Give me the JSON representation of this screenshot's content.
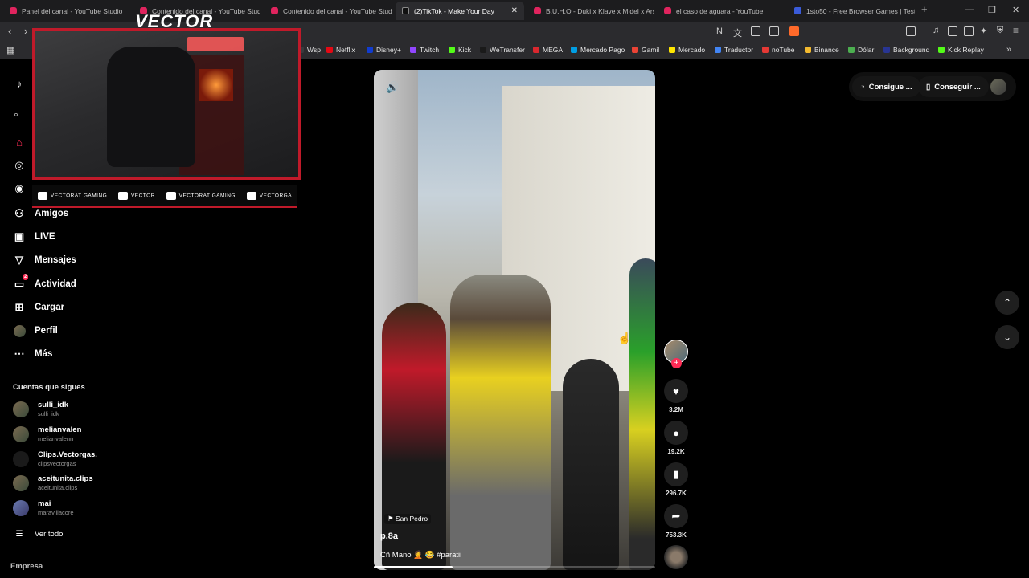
{
  "browser": {
    "tabs": [
      {
        "title": "Panel del canal - YouTube Studio",
        "icon": "youtube-studio-icon",
        "active": false
      },
      {
        "title": "Contenido del canal - YouTube Studio",
        "icon": "youtube-studio-icon",
        "active": false
      },
      {
        "title": "Contenido del canal - YouTube Studio",
        "icon": "youtube-studio-icon",
        "active": false
      },
      {
        "title": "(2)TikTok - Make Your Day",
        "icon": "tiktok-icon",
        "active": true
      },
      {
        "title": "B.U.H.O - Duki x Klave x Midel x Arse",
        "icon": "youtube-icon",
        "active": false
      },
      {
        "title": "el caso de aguara - YouTube",
        "icon": "youtube-icon",
        "active": false
      },
      {
        "title": "1sto50 - Free Browser Games | Test Y",
        "icon": "games-icon",
        "active": false
      }
    ],
    "new_tab": "+",
    "bookmarks": [
      {
        "label": "Wsp",
        "color": "#3a3a3d"
      },
      {
        "label": "Netflix",
        "color": "#e50914"
      },
      {
        "label": "Disney+",
        "color": "#113ccf"
      },
      {
        "label": "Twitch",
        "color": "#9146ff"
      },
      {
        "label": "Kick",
        "color": "#53fc18"
      },
      {
        "label": "WeTransfer",
        "color": "#1a1a1a"
      },
      {
        "label": "MEGA",
        "color": "#d9272e"
      },
      {
        "label": "Mercado Pago",
        "color": "#009ee3"
      },
      {
        "label": "Gamil",
        "color": "#ea4335"
      },
      {
        "label": "Mercado",
        "color": "#ffe600"
      },
      {
        "label": "Traductor",
        "color": "#4285f4"
      },
      {
        "label": "noTube",
        "color": "#e53935"
      },
      {
        "label": "Binance",
        "color": "#f3ba2f"
      },
      {
        "label": "Dólar",
        "color": "#4caf50"
      },
      {
        "label": "Background",
        "color": "#283593"
      },
      {
        "label": "Kick Replay",
        "color": "#53fc18"
      }
    ]
  },
  "overlay": {
    "brand": "VECTOR",
    "socials": [
      {
        "label": "VECTORAT GAMING",
        "icon": "youtube-icon"
      },
      {
        "label": "VECTOR",
        "icon": "twitch-icon"
      },
      {
        "label": "VECTORAT GAMING",
        "icon": "twitter-icon"
      },
      {
        "label": "VECTORGA",
        "icon": "instagram-icon"
      }
    ]
  },
  "sidebar": {
    "nav": [
      {
        "label": "Amigos",
        "icon": "friends-icon"
      },
      {
        "label": "LIVE",
        "icon": "live-icon"
      },
      {
        "label": "Mensajes",
        "icon": "messages-icon"
      },
      {
        "label": "Actividad",
        "icon": "activity-icon",
        "badge": "2"
      },
      {
        "label": "Cargar",
        "icon": "upload-icon"
      },
      {
        "label": "Perfil",
        "icon": "profile-icon"
      },
      {
        "label": "Más",
        "icon": "more-icon"
      }
    ],
    "following_title": "Cuentas que sigues",
    "following": [
      {
        "name": "sulli_idk",
        "handle": "sulli_idk_"
      },
      {
        "name": "melianvalen",
        "handle": "melianvalenn"
      },
      {
        "name": "Clips.Vectorgas.",
        "handle": "clipsvectorgas"
      },
      {
        "name": "aceitunita.clips",
        "handle": "aceitunita.clips"
      },
      {
        "name": "mai",
        "handle": "maravillacore"
      }
    ],
    "see_all": "Ver todo",
    "footer": "Empresa"
  },
  "video": {
    "location": "San Pedro",
    "author": "p.8a",
    "caption": "Cñ Mano 🤦 😂 #paratii",
    "progress": 0.28,
    "actions": {
      "likes": "3.2M",
      "comments": "19.2K",
      "saves": "296.7K",
      "shares": "753.3K"
    }
  },
  "header": {
    "get_coins": "Consigue ...",
    "get_app": "Conseguir ..."
  }
}
